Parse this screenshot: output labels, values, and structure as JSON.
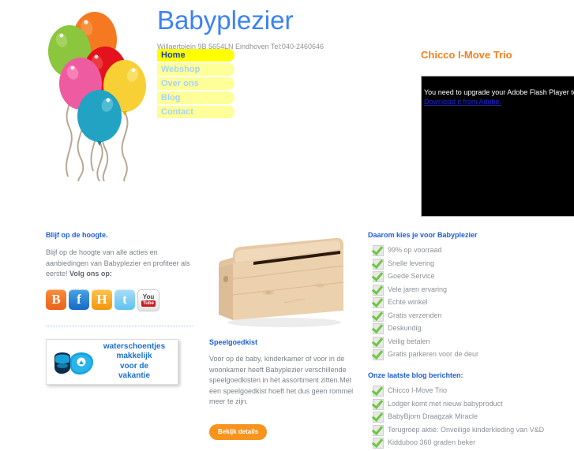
{
  "site": {
    "title": "Babyplezier",
    "address": "Willaertplein 9B 5654LN Eindhoven Tel:040-2460646",
    "title_color": "#3b82f6"
  },
  "nav": {
    "items": [
      {
        "label": "Home",
        "active": true
      },
      {
        "label": "Webshop",
        "active": false
      },
      {
        "label": "Over ons",
        "active": false
      },
      {
        "label": "Blog",
        "active": false
      },
      {
        "label": "Contact",
        "active": false
      }
    ],
    "active_bg": "#ffff00",
    "inactive_bg": "#ffff99"
  },
  "feature": {
    "title": "Chicco I-Move Trio",
    "title_color": "#f5801e",
    "flash_message": "You need to upgrade your Adobe Flash Player to wa",
    "flash_link": "Download it from Adobe."
  },
  "left_column": {
    "heading": "Blijf op de hoogte.",
    "body_pre": "Blijf op de hoogte van alle acties en aanbiedingen van Babyplezier en profiteer als eerste! ",
    "body_bold": "Volg ons op:",
    "social": [
      {
        "name": "blogger-icon",
        "glyph": "B"
      },
      {
        "name": "facebook-icon",
        "glyph": "f"
      },
      {
        "name": "hyves-icon",
        "glyph": "H"
      },
      {
        "name": "twitter-icon",
        "glyph": "t"
      },
      {
        "name": "youtube-icon",
        "glyph_top": "You",
        "glyph_bottom": "Tube"
      }
    ],
    "banner": {
      "line1": "waterschoentjes",
      "line2": "makkelijk",
      "line3": "voor de",
      "line4": "vakantie"
    }
  },
  "middle_column": {
    "image_alt": "houten speelgoedkist",
    "heading": "Speelgoedkist",
    "body": "Voor op de baby, kinderkamer of voor in de woonkamer heeft Babyplezier verschillende speelgoedkisten in het assortiment zitten.Met een speelgoedkist hoeft het dus geen rommel meer te zijn.",
    "button": "Bekijk details",
    "button_color": "#f7941e"
  },
  "right_column": {
    "reasons_heading": "Daarom kies je voor Babyplezier",
    "reasons": [
      "99% op voorraad",
      "Snelle levering",
      "Goede Service",
      "Vele jaren ervaring",
      "Echte winkel",
      "Gratis verzenden",
      "Deskundig",
      "Veilig betalen",
      "Gratis parkeren voor de deur"
    ],
    "blog_heading": "Onze laatste blog berichten:",
    "blog_posts": [
      "Chicco I-Move Trio",
      "Lodger komt met nieuw babyproduct",
      "BabyBjorn Draagzak Miracle",
      "Terugroep aktie: Onveilige kinderkleding van V&D",
      "Kidduboo 360 graden beker"
    ]
  }
}
